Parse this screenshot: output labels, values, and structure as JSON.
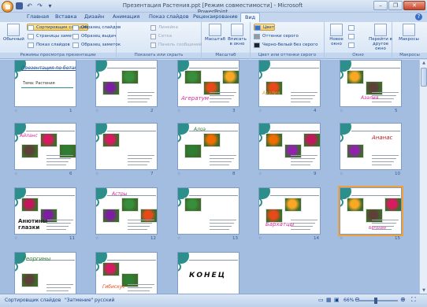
{
  "window": {
    "title": "Презентация Растения.ppt [Режим совместимости] - Microsoft PowerPoint"
  },
  "tabs": [
    "Главная",
    "Вставка",
    "Дизайн",
    "Анимация",
    "Показ слайдов",
    "Рецензирование",
    "Вид"
  ],
  "active_tab": "Вид",
  "ribbon": {
    "views": {
      "label": "Режимы просмотра презентации",
      "normal": "Обычный",
      "sorter": "Сортировщик слайдов",
      "notes": "Страницы заметок",
      "show": "Показ слайдов",
      "slide_master": "Образец слайдов",
      "handout_master": "Образец выдач",
      "notes_master": "Образец заметок"
    },
    "show_hide": {
      "label": "Показать или скрыть",
      "ruler": "Линейка",
      "grid": "Сетка",
      "msgbar": "Панель сообщений"
    },
    "zoom": {
      "label": "Масштаб",
      "zoom": "Масштаб",
      "fit": "Вписать в окно"
    },
    "color": {
      "label": "Цвет или оттенки серого",
      "color": "Цвет",
      "gray": "Оттенки серого",
      "bw": "Черно-белый без серого"
    },
    "window": {
      "label": "Окно",
      "new": "Новое окно",
      "switch": "Перейти в другое окно"
    },
    "macros": {
      "label": "Макросы",
      "btn": "Макросы"
    }
  },
  "slides": [
    {
      "num": "1",
      "title": "Презентация по ботанике",
      "subtitle": "Тема: Растения"
    },
    {
      "num": "2",
      "title": ""
    },
    {
      "num": "3",
      "title": "Агератум"
    },
    {
      "num": "4",
      "title": "Азалия"
    },
    {
      "num": "5",
      "title": "Азалия"
    },
    {
      "num": "6",
      "title": "Айланс"
    },
    {
      "num": "7",
      "title": ""
    },
    {
      "num": "8",
      "title": "Алоэ"
    },
    {
      "num": "9",
      "title": ""
    },
    {
      "num": "10",
      "title": "Ананас"
    },
    {
      "num": "11",
      "title": "Анютины глазки"
    },
    {
      "num": "12",
      "title": "Астры"
    },
    {
      "num": "13",
      "title": ""
    },
    {
      "num": "14",
      "title": "Бархатцы"
    },
    {
      "num": "15",
      "title": "Бегония"
    },
    {
      "num": "16",
      "title": "Георгины"
    },
    {
      "num": "17",
      "title": "Гибискус"
    },
    {
      "num": "18",
      "title": "КОНЕЦ"
    }
  ],
  "statusbar": {
    "view": "Сортировщик слайдов",
    "theme": "\"Затмение\"",
    "lang": "русский",
    "zoom": "66%"
  },
  "colors": {
    "accent_orange": "#f0a03c",
    "teal": "#2c8f8c",
    "title_pink": "#d62a9a",
    "title_green": "#2e7d32"
  }
}
